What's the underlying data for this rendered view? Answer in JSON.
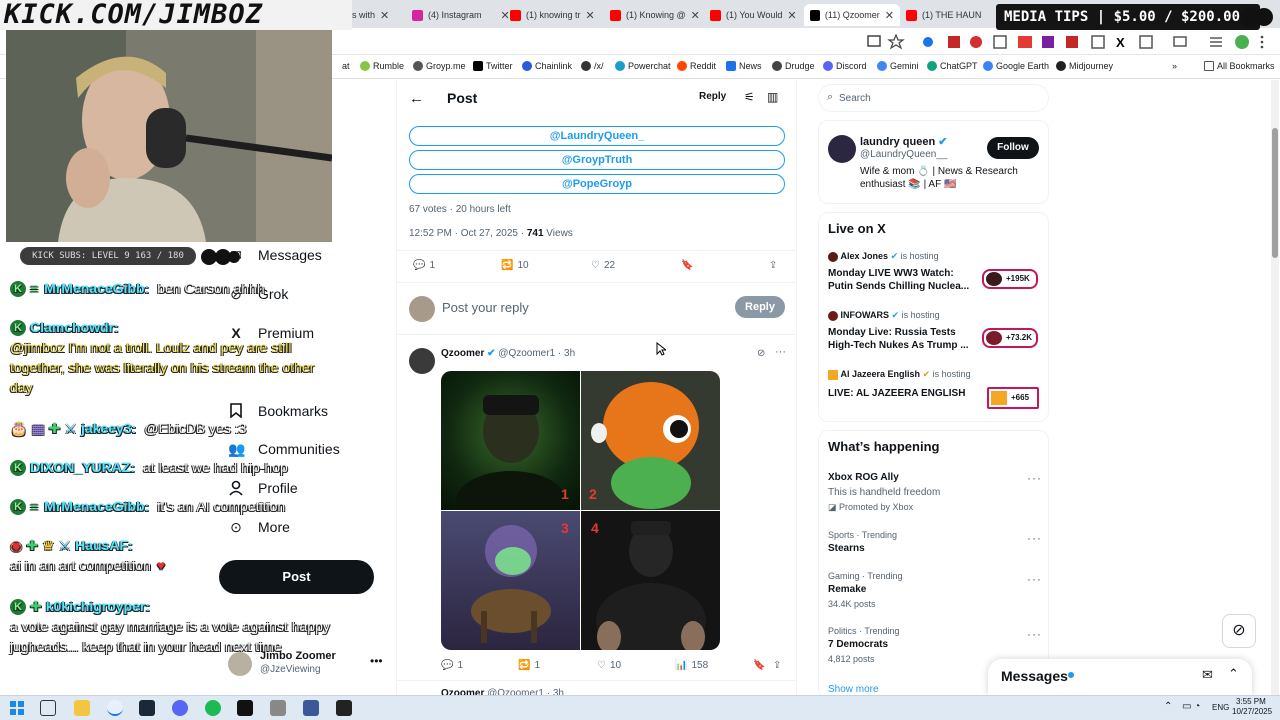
{
  "overlay": {
    "kick_url": "KICK.COM/JIMBOZ",
    "media_tips": "MEDIA TIPS | $5.00 / $200.00",
    "subs_label": "KICK SUBS: LEVEL 9 163 / 180",
    "chat": [
      {
        "user": "MrMenaceGibb:",
        "text": "ben Carson ahhh"
      },
      {
        "user": "Clamchowdr:",
        "text": "@jimboz I'm not a troll. Loulz and pey are still together, she was literally on his stream the other day"
      },
      {
        "user": "jakeey3:",
        "text": "@EbicDB yes :3"
      },
      {
        "user": "DIXON_YURAZ:",
        "text": "at least we had hip-hop"
      },
      {
        "user": "MrMenaceGibb:",
        "text": "it's an AI competition"
      },
      {
        "user": "HausAF:",
        "text": "ai in an art competition"
      },
      {
        "user": "k0kichigroyper:",
        "text": "a vote against gay marriage is a vote against happy jugheads... keep that in your head next time"
      }
    ]
  },
  "browser": {
    "tabs": [
      {
        "label": "s with",
        "color": "#999"
      },
      {
        "label": "(4) Instagram",
        "color": "#d6249f"
      },
      {
        "label": "(1) knowing tr",
        "color": "#ff0000"
      },
      {
        "label": "(1) Knowing @",
        "color": "#ff0000"
      },
      {
        "label": "(1) You Would",
        "color": "#ff0000"
      },
      {
        "label": "(11) Qzoomer",
        "color": "#000"
      },
      {
        "label": "(1) THE HAUN",
        "color": "#ff0000"
      }
    ],
    "bookmarks": [
      "at",
      "Rumble",
      "Groyp.me",
      "Twitter",
      "Chainlink",
      "/x/",
      "Powerchat",
      "Reddit",
      "News",
      "Drudge",
      "Discord",
      "Gemini",
      "ChatGPT",
      "Google Earth",
      "Midjourney",
      "All Bookmarks"
    ],
    "bookmark_colors": [
      "#888",
      "#85c742",
      "#555",
      "#000",
      "#2a5ada",
      "#333",
      "#1aa0c8",
      "#ff4500",
      "#1a73e8",
      "#444",
      "#5865f2",
      "#4285f4",
      "#10a37f",
      "#3b82f6",
      "#222",
      "#555"
    ]
  },
  "nav": {
    "items": [
      {
        "label": "Messages",
        "icon": "mail-icon"
      },
      {
        "label": "Grok",
        "icon": "grok-icon"
      },
      {
        "label": "Premium",
        "icon": "x-logo-icon"
      },
      {
        "label": "Bookmarks",
        "icon": "bookmark-icon"
      },
      {
        "label": "Communities",
        "icon": "people-icon"
      },
      {
        "label": "Profile",
        "icon": "person-icon"
      },
      {
        "label": "More",
        "icon": "more-circle-icon"
      }
    ],
    "post_label": "Post",
    "account_name": "Jimbo Zoomer",
    "account_handle": "@JzeViewing"
  },
  "post_header": {
    "title": "Post",
    "reply_label": "Reply"
  },
  "poll": {
    "options": [
      "@LaundryQueen_",
      "@GroypTruth",
      "@PopeGroyp"
    ],
    "meta": "67 votes · 20 hours left",
    "time": "12:52 PM · Oct 27, 2025 · ",
    "views_count": "741",
    "views_label": " Views",
    "replies": "1",
    "reposts": "10",
    "likes": "22"
  },
  "reply_box": {
    "placeholder": "Post your reply",
    "button": "Reply"
  },
  "tweet": {
    "name": "Qzoomer",
    "handle": "@Qzoomer1 · 3h",
    "image_numbers": [
      "1",
      "2",
      "3",
      "4"
    ],
    "replies": "1",
    "reposts": "1",
    "likes": "10",
    "views": "158",
    "next_name": "Qzoomer",
    "next_handle": "@Qzoomer1 · 3h"
  },
  "search": {
    "placeholder": "Search"
  },
  "profile_card": {
    "name": "laundry queen",
    "handle": "@LaundryQueen__",
    "bio": "Wife & mom 💍 | News & Research enthusiast 📚 | AF 🇺🇸",
    "follow": "Follow"
  },
  "live": {
    "title": "Live on X",
    "items": [
      {
        "host": "Alex Jones",
        "status": "is hosting",
        "title": "Monday LIVE WW3 Watch: Putin Sends Chilling Nuclea...",
        "count": "+195K"
      },
      {
        "host": "INFOWARS",
        "status": "is hosting",
        "title": "Monday Live: Russia Tests High-Tech Nukes As Trump ...",
        "count": "+73.2K"
      },
      {
        "host": "Al Jazeera English",
        "status": "is hosting",
        "title": "LIVE: AL JAZEERA ENGLISH",
        "count": "+665"
      }
    ]
  },
  "happening": {
    "title": "What’s happening",
    "items": [
      {
        "meta": "",
        "topic": "Xbox ROG Ally",
        "sub": "This is handheld freedom",
        "promo": "Promoted by Xbox"
      },
      {
        "meta": "Sports · Trending",
        "topic": "Stearns",
        "sub": ""
      },
      {
        "meta": "Gaming · Trending",
        "topic": "Remake",
        "sub": "34.4K posts"
      },
      {
        "meta": "Politics · Trending",
        "topic": "7 Democrats",
        "sub": "4,812 posts"
      }
    ],
    "show_more": "Show more"
  },
  "messages_dock": {
    "label": "Messages"
  },
  "taskbar": {
    "lang": "ENG",
    "time": "3:55 PM",
    "date": "10/27/2025"
  },
  "colors": {
    "accent": "#1d9bf0",
    "chat_user": "#53e3ff",
    "chat_yellow": "#f7e65c"
  }
}
